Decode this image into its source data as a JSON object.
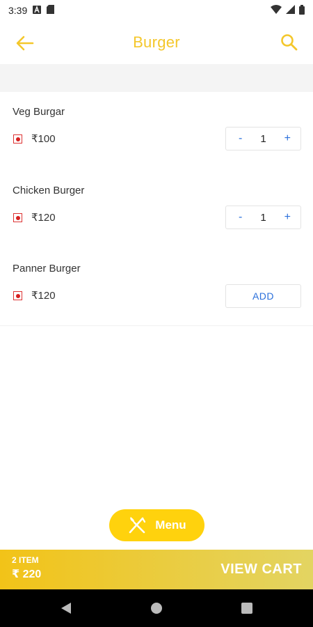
{
  "status_bar": {
    "time": "3:39"
  },
  "header": {
    "title": "Burger"
  },
  "items": [
    {
      "name": "Veg Burgar",
      "price": "₹100",
      "qty": "1"
    },
    {
      "name": "Chicken Burger",
      "price": "₹120",
      "qty": "1"
    },
    {
      "name": "Panner Burger",
      "price": "₹120",
      "action_label": "ADD"
    }
  ],
  "qty_controls": {
    "minus": "-",
    "plus": "+"
  },
  "menu_button": {
    "label": "Menu"
  },
  "cart": {
    "count": "2 ITEM",
    "total": "₹ 220",
    "action": "VIEW CART"
  },
  "colors": {
    "accent": "#f4c72b",
    "menu_pill": "#ffd20d",
    "link_blue": "#2a6fdb",
    "nonveg_marker": "#d62020"
  },
  "icons": {
    "back": "arrow-left-icon",
    "search": "search-icon",
    "menu": "fork-knife-icon",
    "nav_back": "triangle-back-icon",
    "nav_home": "circle-home-icon",
    "nav_recents": "square-recents-icon"
  }
}
